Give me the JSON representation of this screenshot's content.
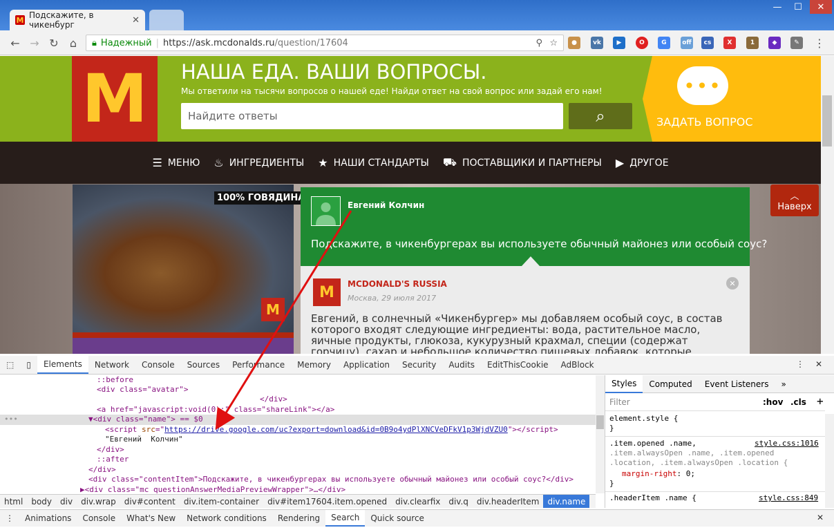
{
  "browser": {
    "tab_title": "Подскажите, в чикенбург",
    "security_label": "Надежный",
    "url_host": "https://ask.mcdonalds.ru",
    "url_path": "/question/17604"
  },
  "site": {
    "headline": "НАША ЕДА. ВАШИ ВОПРОСЫ.",
    "subheadline": "Мы ответили на тысячи вопросов о нашей еде! Найди ответ на свой вопрос или задай его нам!",
    "search_placeholder": "Найдите ответы",
    "ask_button": "ЗАДАТЬ ВОПРОС",
    "nav": [
      "МЕНЮ",
      "ИНГРЕДИЕНТЫ",
      "НАШИ СТАНДАРТЫ",
      "ПОСТАВЩИКИ И ПАРТНЕРЫ",
      "ДРУГОЕ"
    ],
    "image_label": "100% ГОВЯДИНА",
    "to_top": "Наверх",
    "question": {
      "author": "Евгений Колчин",
      "text": "Подскажите, в чикенбургерах вы используете обычный майонез или особый соус?"
    },
    "answer": {
      "author": "MCDONALD'S RUSSIA",
      "date": "Москва, 29 июля 2017",
      "text": "Евгений, в солнечный «Чикенбургер» мы добавляем особый соус, в состав которого входят следующие ингредиенты: вода, растительное масло, яичные продукты, глюкоза, кукурузный крахмал, специи (содержат горчицу), сахар и небольшое количество пищевых добавок, которые регулярно применяются в"
    }
  },
  "devtools": {
    "tabs": [
      "Elements",
      "Network",
      "Console",
      "Sources",
      "Performance",
      "Memory",
      "Application",
      "Security",
      "Audits",
      "EditThisCookie",
      "AdBlock"
    ],
    "dom_lines": [
      "::before",
      "<div class=\"avatar\">",
      "</div>",
      "<a href=\"javascript:void(0);\" class=\"shareLink\"></a>",
      "<div class=\"name\"> == $0",
      "https://drive.google.com/uc?export=download&id=0B9o4ydPlXNCVeDFkV1p3WjdVZU0",
      "\"Евгений  Колчин\"",
      "</div>",
      "::after",
      "</div>",
      "<div class=\"contentItem\">Подскажите, в чикенбургерах вы используете обычный майонез или особый соус?</div>",
      "<div class=\"mc_questionAnswerMediaPreviewWrapper\">…</div>"
    ],
    "breadcrumbs": [
      "html",
      "body",
      "div",
      "div.wrap",
      "div#content",
      "div.item-container",
      "div#item17604.item.opened",
      "div.clearfix",
      "div.q",
      "div.headerItem",
      "div.name"
    ],
    "styles_tabs": [
      "Styles",
      "Computed",
      "Event Listeners"
    ],
    "filter_placeholder": "Filter",
    "hov": ":hov",
    "cls": ".cls",
    "rules": {
      "element_style": "element.style {",
      "rule1_selector": ".item.opened .name,",
      "rule1_selector2": ".item.alwaysOpen .name, .item.opened",
      "rule1_selector3": ".location, .item.alwaysOpen .location {",
      "rule1_source": "style.css:1016",
      "rule1_prop": "margin-right",
      "rule1_value": "0;",
      "rule2_selector": ".headerItem .name {",
      "rule2_source": "style.css:849"
    },
    "drawer_tabs": [
      "Animations",
      "Console",
      "What's New",
      "Network conditions",
      "Rendering",
      "Search",
      "Quick source"
    ]
  }
}
